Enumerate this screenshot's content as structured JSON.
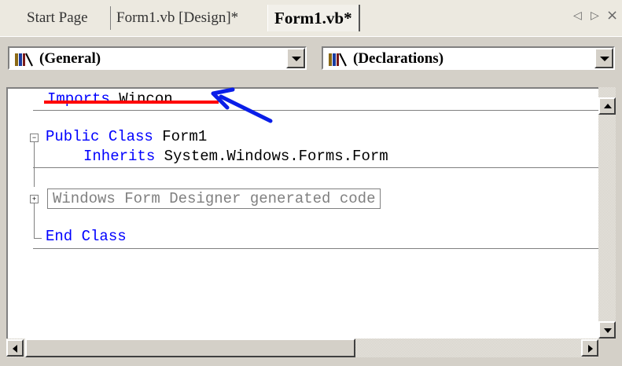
{
  "tabs": [
    {
      "label": "Start Page",
      "active": false
    },
    {
      "label": "Form1.vb [Design]*",
      "active": false
    },
    {
      "label": "Form1.vb*",
      "active": true
    }
  ],
  "tab_nav": {
    "prev": "◁",
    "next": "▷",
    "close": "×"
  },
  "dropdowns": {
    "object": {
      "value": "(General)",
      "icon": "class-icon"
    },
    "member": {
      "value": "(Declarations)",
      "icon": "class-icon"
    }
  },
  "code": {
    "line1": {
      "keyword": "Imports",
      "rest": " Wincon"
    },
    "line2": {
      "keyword": "Public Class",
      "rest": " Form1"
    },
    "line3": {
      "keyword": "Inherits",
      "rest": " System.Windows.Forms.Form"
    },
    "region": "Windows Form Designer generated code",
    "line5": {
      "keyword": "End Class",
      "rest": ""
    }
  },
  "annotation": {
    "underline_color": "#ff0000",
    "arrow_color": "#0000ff"
  },
  "colors": {
    "keyword": "#0000ff",
    "text": "#000000",
    "collapsed_region": "#808080"
  }
}
